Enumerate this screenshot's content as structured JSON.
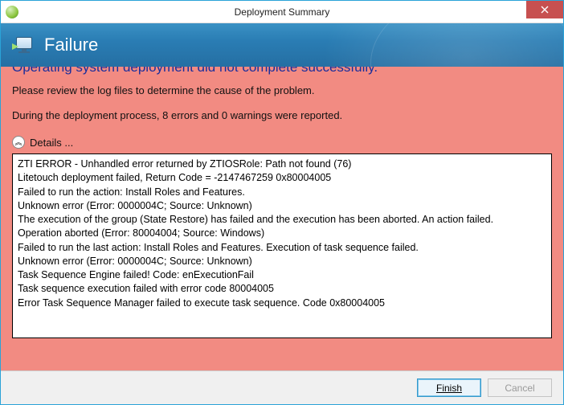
{
  "window": {
    "title": "Deployment Summary"
  },
  "banner": {
    "title": "Failure"
  },
  "content": {
    "heading": "Operating system deployment did not complete successfully.",
    "review_msg": "Please review the log files to determine the cause of the problem.",
    "counts_msg": "During the deployment process, 8 errors and 0 warnings were reported.",
    "details_label": "Details ...",
    "log_lines": [
      "ZTI ERROR - Unhandled error returned by ZTIOSRole: Path not found (76)",
      "Litetouch deployment failed, Return Code = -2147467259  0x80004005",
      "Failed to run the action: Install Roles and Features.",
      "Unknown error (Error: 0000004C; Source: Unknown)",
      "The execution of the group (State Restore) has failed and the execution has been aborted. An action failed.",
      "Operation aborted (Error: 80004004; Source: Windows)",
      "Failed to run the last action: Install Roles and Features. Execution of task sequence failed.",
      "Unknown error (Error: 0000004C; Source: Unknown)",
      "Task Sequence Engine failed! Code: enExecutionFail",
      "Task sequence execution failed with error code 80004005",
      "Error Task Sequence Manager failed to execute task sequence. Code 0x80004005"
    ]
  },
  "footer": {
    "finish_label": "Finish",
    "cancel_label": "Cancel"
  }
}
